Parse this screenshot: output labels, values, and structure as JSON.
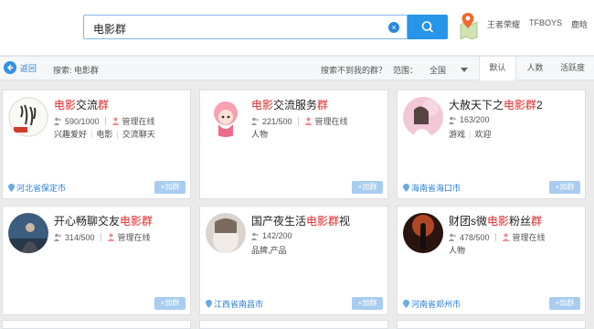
{
  "search": {
    "value": "电影群"
  },
  "quick_links": [
    "王者荣耀",
    "TFBOYS",
    "鹿晗"
  ],
  "nav": {
    "back_label": "返回",
    "search_label": "搜索: 电影群",
    "not_found_label": "搜索不到我的群？",
    "range_label": "范围：",
    "range_value": "全国",
    "sort_tabs": [
      "默认",
      "人数",
      "活跃度"
    ]
  },
  "cards": [
    {
      "title_pre": "",
      "title_hl1": "电影",
      "title_mid": "交流",
      "title_hl2": "群",
      "title_post": "",
      "members": "590/1000",
      "admin": "管理在线",
      "tags": [
        "兴趣爱好",
        "电影",
        "交流聊天"
      ],
      "location": "河北省保定市",
      "join_label": "+加群"
    },
    {
      "title_pre": "",
      "title_hl1": "电影",
      "title_mid": "交流服务",
      "title_hl2": "群",
      "title_post": "",
      "members": "221/500",
      "admin": "管理在线",
      "tags": [
        "人物"
      ],
      "location": "",
      "join_label": "+加群"
    },
    {
      "title_pre": "大赦天下之",
      "title_hl1": "电影",
      "title_mid": "",
      "title_hl2": "群",
      "title_post": "2",
      "members": "163/200",
      "admin": "",
      "tags": [
        "游戏",
        "欢迎"
      ],
      "location": "海南省海口市",
      "join_label": "+加群"
    },
    {
      "title_pre": "开心畅聊交友",
      "title_hl1": "电影",
      "title_mid": "",
      "title_hl2": "群",
      "title_post": "",
      "members": "314/500",
      "admin": "管理在线",
      "tags": [],
      "location": "",
      "join_label": "+加群"
    },
    {
      "title_pre": "国产夜生活",
      "title_hl1": "电影",
      "title_mid": "",
      "title_hl2": "群",
      "title_post": "视",
      "members": "142/200",
      "admin": "",
      "tags": [
        "品牌,产品"
      ],
      "location": "江西省南昌市",
      "join_label": "+加群"
    },
    {
      "title_pre": "财团s微",
      "title_hl1": "电影",
      "title_mid": "粉丝",
      "title_hl2": "群",
      "title_post": "",
      "members": "478/500",
      "admin": "管理在线",
      "tags": [
        "人物"
      ],
      "location": "河南省郑州市",
      "join_label": "+加群"
    }
  ]
}
